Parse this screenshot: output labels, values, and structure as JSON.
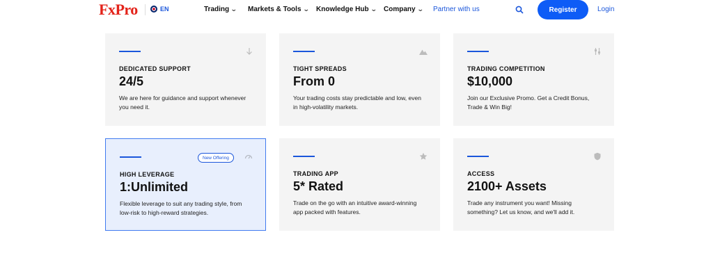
{
  "header": {
    "logo": "FxPro",
    "lang": "EN",
    "nav": [
      {
        "label": "Trading"
      },
      {
        "label": "Markets & Tools"
      },
      {
        "label": "Knowledge Hub"
      },
      {
        "label": "Company"
      }
    ],
    "partner": "Partner with us",
    "register": "Register",
    "login": "Login"
  },
  "cards": [
    {
      "kicker": "DEDICATED SUPPORT",
      "headline": "24/5",
      "desc": "We are here for guidance and support whenever you need it.",
      "icon": "arrow-down-icon"
    },
    {
      "kicker": "TIGHT SPREADS",
      "headline": "From 0",
      "desc": "Your trading costs stay predictable and low, even in high-volatility markets.",
      "icon": "mountain-icon"
    },
    {
      "kicker": "TRADING COMPETITION",
      "headline": "$10,000",
      "desc": "Join our Exclusive Promo. Get a Credit Bonus, Trade & Win Big!",
      "icon": "sliders-icon"
    },
    {
      "kicker": "HIGH LEVERAGE",
      "headline": "1:Unlimited",
      "desc": "Flexible leverage to suit any trading style, from low-risk to high-reward strategies.",
      "icon": "gauge-icon",
      "badge": "New Offering"
    },
    {
      "kicker": "TRADING APP",
      "headline": "5* Rated",
      "desc": "Trade on the go with an intuitive award-winning app packed with features.",
      "icon": "star-icon"
    },
    {
      "kicker": "ACCESS",
      "headline": "2100+ Assets",
      "desc": "Trade any instrument you want! Missing something? Let us know, and we'll add it.",
      "icon": "shield-icon"
    }
  ],
  "colors": {
    "brand_red": "#e32219",
    "accent_blue": "#0e5cf6",
    "card_bg": "#f4f4f4",
    "highlight_bg": "#e8effd"
  }
}
